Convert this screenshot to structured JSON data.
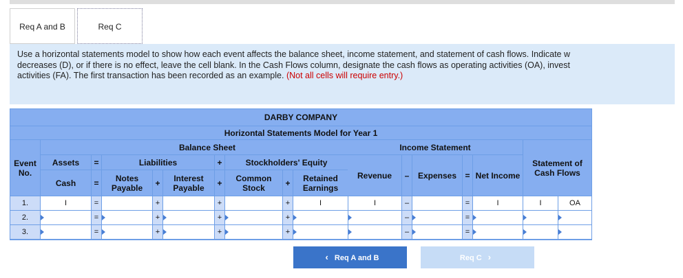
{
  "tabs": [
    {
      "label": "Req A and B"
    },
    {
      "label": "Req C"
    }
  ],
  "instructions": {
    "line1": "Use a horizontal statements model to show how each event affects the balance sheet, income statement, and statement of cash flows. Indicate w",
    "line2": "decreases (D), or if there is no effect, leave the cell blank. In the Cash Flows column, designate the cash flows as operating activities (OA), invest",
    "line3": "activities (FA). The first transaction has been recorded as an example.",
    "note": "(Not all cells will require entry.)"
  },
  "table": {
    "company": "DARBY COMPANY",
    "subtitle": "Horizontal Statements Model for Year 1",
    "balance_sheet": "Balance Sheet",
    "income_statement": "Income Statement",
    "statement_of_cash_flows": "Statement of Cash Flows",
    "event_no": "Event No.",
    "assets": "Assets",
    "liabilities": "Liabilities",
    "stockholders_equity": "Stockholders' Equity",
    "cash": "Cash",
    "notes_payable": "Notes Payable",
    "interest_payable": "Interest Payable",
    "common_stock": "Common Stock",
    "retained_earnings": "Retained Earnings",
    "revenue": "Revenue",
    "expenses": "Expenses",
    "net_income": "Net Income",
    "ops": {
      "eq": "=",
      "plus": "+",
      "minus": "–"
    },
    "rows": [
      {
        "event": "1.",
        "cash": "I",
        "notes": "",
        "interest": "",
        "common": "",
        "retained": "I",
        "revenue": "I",
        "expenses": "",
        "net_income": "I",
        "cf_amount": "I",
        "cf_class": "OA"
      },
      {
        "event": "2.",
        "cash": "",
        "notes": "",
        "interest": "",
        "common": "",
        "retained": "",
        "revenue": "",
        "expenses": "",
        "net_income": "",
        "cf_amount": "",
        "cf_class": ""
      },
      {
        "event": "3.",
        "cash": "",
        "notes": "",
        "interest": "",
        "common": "",
        "retained": "",
        "revenue": "",
        "expenses": "",
        "net_income": "",
        "cf_amount": "",
        "cf_class": ""
      }
    ]
  },
  "nav": {
    "prev_label": "Req A and B",
    "next_label": "Req C",
    "prev_icon": "chevron-left-icon",
    "next_icon": "chevron-right-icon"
  }
}
